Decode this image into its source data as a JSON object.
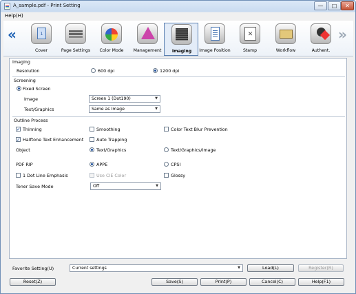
{
  "window": {
    "title": "A_sample.pdf - Print Setting",
    "min_glyph": "—",
    "max_glyph": "□",
    "close_glyph": "✕"
  },
  "menu": {
    "help": "Help(H)"
  },
  "tabs": {
    "prev_glyph": "«",
    "next_glyph": "»",
    "items": [
      {
        "label": "Cover",
        "icon": "cover-icon"
      },
      {
        "label": "Page Settings",
        "icon": "page-settings-icon"
      },
      {
        "label": "Color Mode",
        "icon": "color-mode-icon"
      },
      {
        "label": "Management",
        "icon": "management-icon"
      },
      {
        "label": "Imaging",
        "icon": "imaging-icon",
        "active": true
      },
      {
        "label": "Image Position",
        "icon": "image-position-icon"
      },
      {
        "label": "Stamp",
        "icon": "stamp-icon"
      },
      {
        "label": "Workflow",
        "icon": "workflow-icon"
      },
      {
        "label": "Authent.",
        "icon": "authentication-icon"
      }
    ],
    "cover_glyph": "1",
    "stamp_glyph": "✕"
  },
  "imaging": {
    "section": "Imaging",
    "resolution_label": "Resolution",
    "res_600": "600 dpi",
    "res_1200": "1200 dpi",
    "selected_resolution": "1200 dpi"
  },
  "screening": {
    "section": "Screening",
    "fixed_screen": "Fixed Screen",
    "fixed_screen_checked": true,
    "image_label": "Image",
    "image_value": "Screen 1 (Dot190)",
    "text_label": "Text/Graphics",
    "text_value": "Same as Image"
  },
  "outline": {
    "section": "Outline Process",
    "thinning": "Thinning",
    "thinning_checked": true,
    "smoothing": "Smoothing",
    "smoothing_checked": false,
    "blur": "Color Text Blur Prevention",
    "blur_checked": false,
    "halftone": "Halftone Text Enhancement",
    "halftone_checked": true,
    "trapping": "Auto Trapping",
    "trapping_checked": false,
    "object_label": "Object",
    "object_text": "Text/Graphics",
    "object_all": "Text/Graphics/Image",
    "selected_object": "Text/Graphics"
  },
  "misc": {
    "pdf_rip_label": "PDF RIP",
    "apre": "APPE",
    "cpsi": "CPSI",
    "selected_rip": "APPE",
    "dot_line": "1 Dot Line Emphasis",
    "dot_line_checked": false,
    "cie": "Use CIE Color",
    "cie_checked": false,
    "glossy": "Glossy",
    "glossy_checked": false,
    "toner_label": "Toner Save Mode",
    "toner_value": "Off"
  },
  "favorite": {
    "label": "Favorite Setting(U)",
    "value": "Current settings",
    "load": "Load(L)",
    "register": "Register(R)"
  },
  "buttons": {
    "reset": "Reset(Z)",
    "save": "Save(S)",
    "print": "Print(P)",
    "cancel": "Cancel(C)",
    "help": "Help(F1)"
  },
  "glyphs": {
    "dropdown": "▼",
    "check": "✓"
  },
  "colors": {
    "accent": "#1d4f9b",
    "arrow_active": "#1a5fb4"
  }
}
